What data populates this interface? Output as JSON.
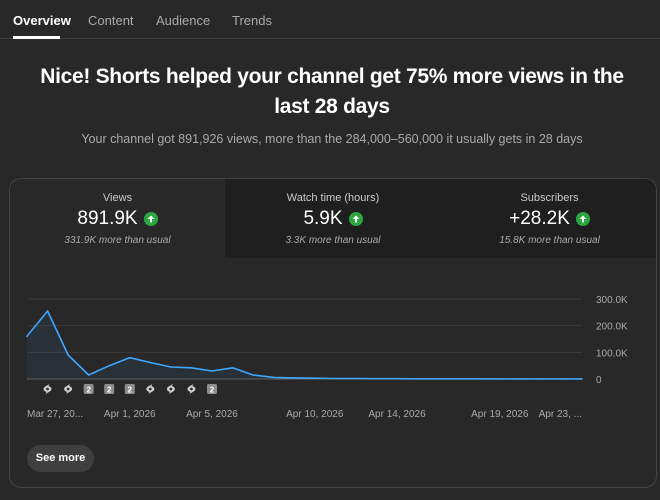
{
  "tabs": [
    {
      "label": "Overview",
      "active": true
    },
    {
      "label": "Content",
      "active": false
    },
    {
      "label": "Audience",
      "active": false
    },
    {
      "label": "Trends",
      "active": false
    }
  ],
  "headline": "Nice! Shorts helped your channel get 75% more views in the last 28 days",
  "subline": "Your channel got 891,926 views, more than the 284,000–560,000 it usually gets in 28 days",
  "metrics": [
    {
      "label": "Views",
      "value": "891.9K",
      "note": "331.9K more than usual",
      "selected": true
    },
    {
      "label": "Watch time (hours)",
      "value": "5.9K",
      "note": "3.3K more than usual",
      "selected": false
    },
    {
      "label": "Subscribers",
      "value": "+28.2K",
      "note": "15.8K more than usual",
      "selected": false
    }
  ],
  "colors": {
    "accent_line": "#3ea6ff",
    "up": "#2ba640",
    "bg": "#282828"
  },
  "chart_data": {
    "type": "line",
    "series": [
      {
        "values": [
          160000,
          255000,
          90000,
          15000,
          50000,
          80000,
          62000,
          45000,
          42000,
          30000,
          42000,
          15000,
          6000,
          4000,
          3000,
          2000,
          1500,
          1200,
          1000,
          900,
          800,
          700,
          600,
          500,
          500,
          400,
          300,
          300
        ]
      }
    ],
    "ylim": [
      0,
      300000
    ],
    "y_ticks": [
      "0",
      "100.0K",
      "200.0K",
      "300.0K"
    ],
    "x_tick_labels": [
      {
        "index": 0,
        "label": "Mar 27, 20..."
      },
      {
        "index": 5,
        "label": "Apr 1, 2026"
      },
      {
        "index": 9,
        "label": "Apr 5, 2026"
      },
      {
        "index": 14,
        "label": "Apr 10, 2026"
      },
      {
        "index": 18,
        "label": "Apr 14, 2026"
      },
      {
        "index": 23,
        "label": "Apr 19, 2026"
      },
      {
        "index": 27,
        "label": "Apr 23, ..."
      }
    ],
    "markers": [
      {
        "index": 1,
        "kind": "shorts",
        "label": ""
      },
      {
        "index": 2,
        "kind": "shorts",
        "label": ""
      },
      {
        "index": 3,
        "kind": "count",
        "label": "2"
      },
      {
        "index": 4,
        "kind": "count",
        "label": "2"
      },
      {
        "index": 5,
        "kind": "count",
        "label": "2"
      },
      {
        "index": 6,
        "kind": "shorts",
        "label": ""
      },
      {
        "index": 7,
        "kind": "shorts",
        "label": ""
      },
      {
        "index": 8,
        "kind": "shorts",
        "label": ""
      },
      {
        "index": 9,
        "kind": "count",
        "label": "2"
      }
    ],
    "grid": true
  },
  "see_more_label": "See more"
}
